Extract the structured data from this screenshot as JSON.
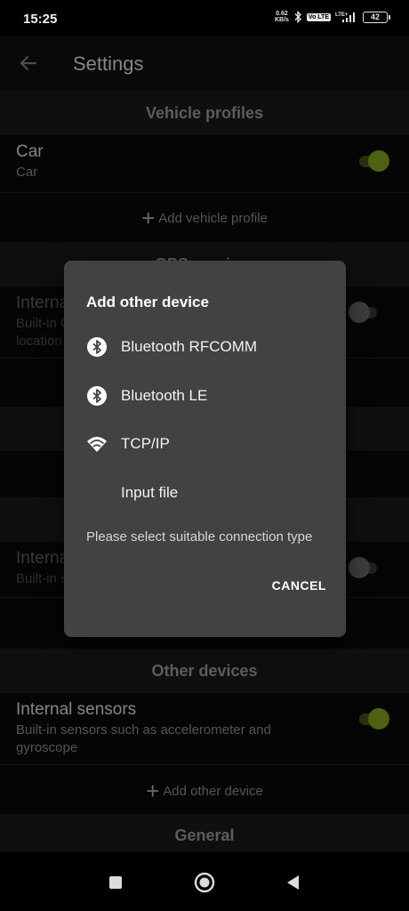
{
  "status_bar": {
    "time": "15:25",
    "net_speed_value": "0.62",
    "net_speed_unit": "KB/s",
    "volte_label": "Vo LTE",
    "lte_label": "LTE+",
    "battery_level": "42"
  },
  "app_bar": {
    "title": "Settings",
    "back_icon": "arrow-back-icon"
  },
  "sections": {
    "vehicle_profiles": {
      "header": "Vehicle profiles",
      "item_title": "Car",
      "item_subtitle": "Car",
      "toggle_on": true,
      "add_label": "Add vehicle profile"
    },
    "gps_partial": {
      "header": "GPS receiver",
      "item_title": "Internal GPS",
      "item_subtitle_line1": "Built-in GPS receiver",
      "item_subtitle_line2": "location",
      "toggle_on": false
    },
    "second_partial": {
      "item_title": "Internal",
      "item_subtitle": "Built-in sensors",
      "toggle_on": false
    },
    "other_devices": {
      "header": "Other devices",
      "item_title": "Internal sensors",
      "item_subtitle": "Built-in sensors such as accelerometer and gyroscope",
      "toggle_on": true,
      "add_label": "Add other device"
    },
    "general": {
      "header": "General"
    }
  },
  "dialog": {
    "title": "Add other device",
    "options": [
      {
        "label": "Bluetooth RFCOMM",
        "icon": "bluetooth-icon"
      },
      {
        "label": "Bluetooth LE",
        "icon": "bluetooth-icon"
      },
      {
        "label": "TCP/IP",
        "icon": "wifi-icon"
      },
      {
        "label": "Input file",
        "icon": ""
      }
    ],
    "message": "Please select suitable connection type",
    "cancel_label": "CANCEL"
  },
  "nav_bar": {
    "recents_icon": "square-icon",
    "home_icon": "circle-home-icon",
    "back_icon": "triangle-back-icon"
  },
  "colors": {
    "accent": "#8fb021",
    "dialog_bg": "#424242",
    "section_header_bg": "#1c1c1c"
  }
}
